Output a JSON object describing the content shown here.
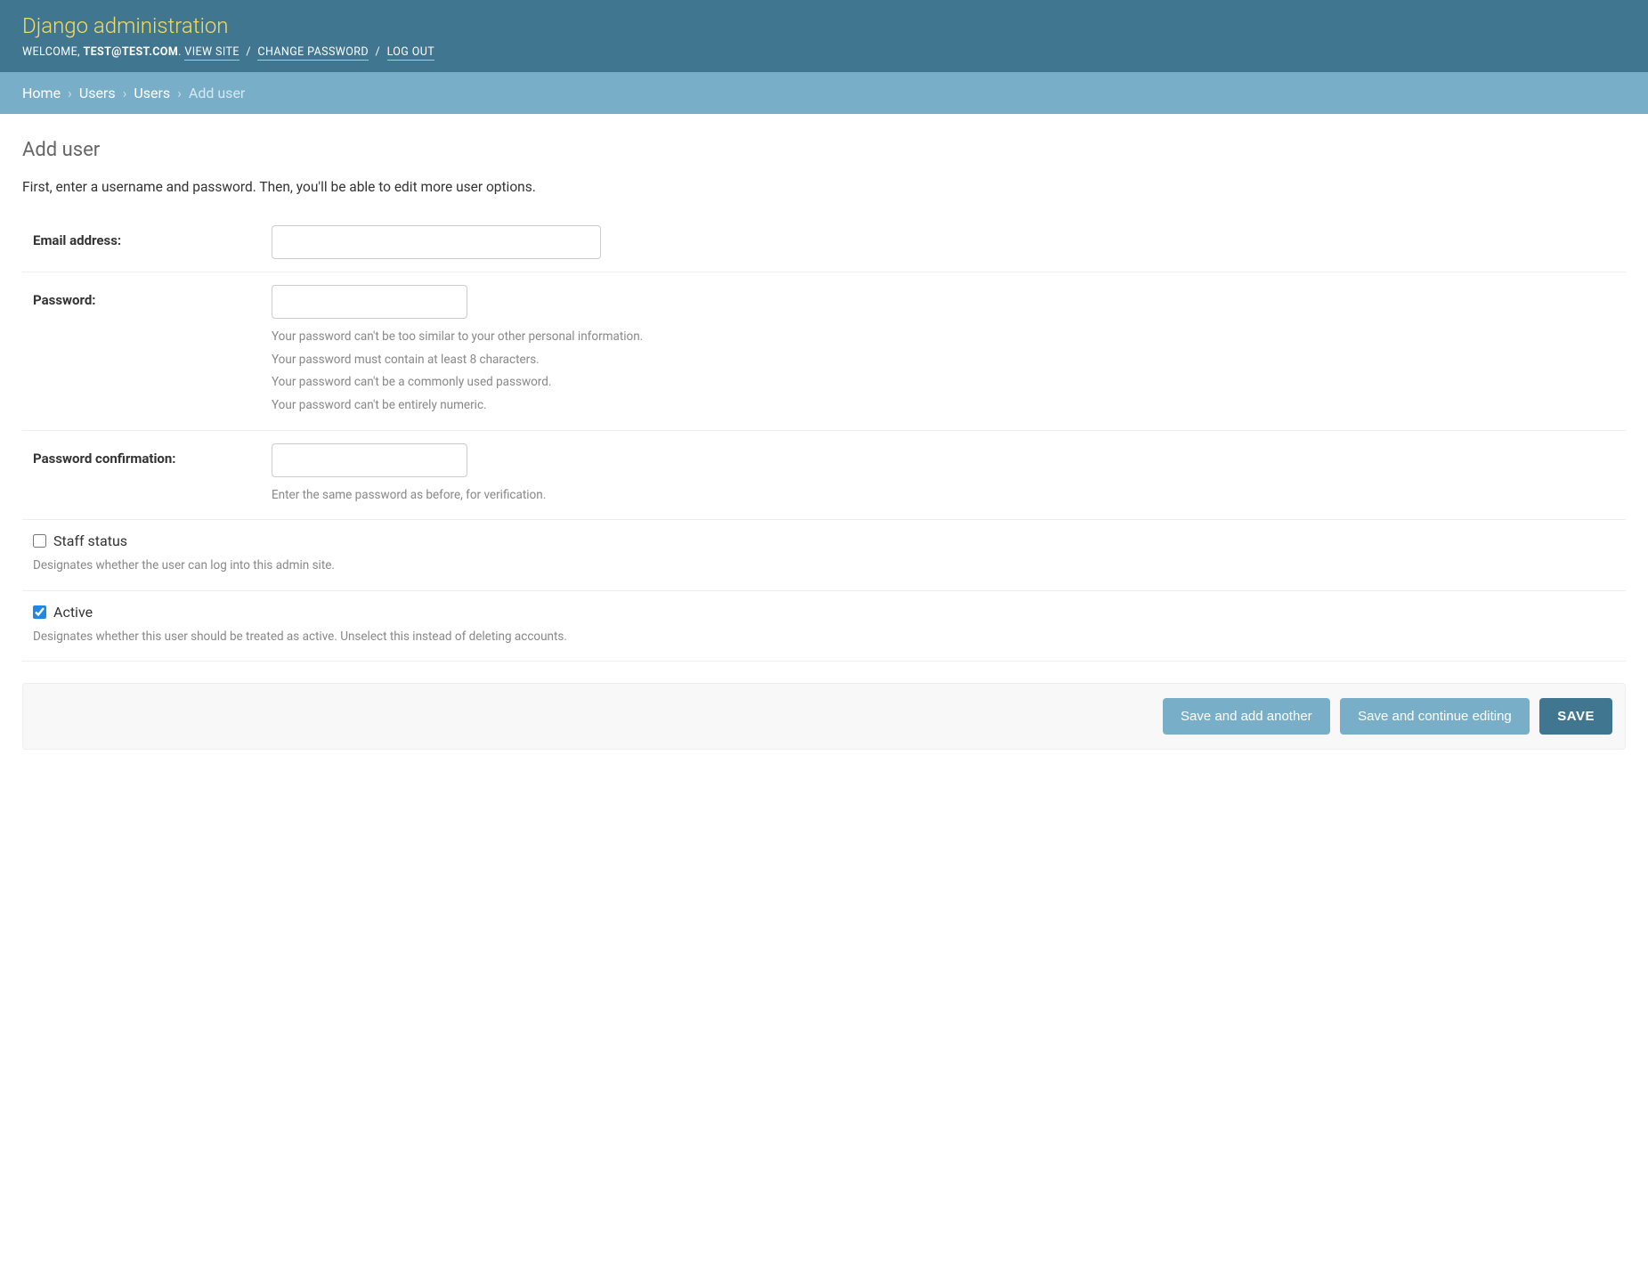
{
  "header": {
    "site_title": "Django administration",
    "welcome": "WELCOME, ",
    "user": "TEST@TEST.COM",
    "view_site": "VIEW SITE",
    "change_password": "CHANGE PASSWORD",
    "logout": "LOG OUT",
    "period": ". ",
    "slash": " / "
  },
  "breadcrumbs": {
    "items": [
      "Home",
      "Users",
      "Users"
    ],
    "current": "Add user",
    "sep": "›"
  },
  "page": {
    "title": "Add user",
    "intro": "First, enter a username and password. Then, you'll be able to edit more user options."
  },
  "fields": {
    "email": {
      "label": "Email address:",
      "value": ""
    },
    "password": {
      "label": "Password:",
      "value": "",
      "help": [
        "Your password can't be too similar to your other personal information.",
        "Your password must contain at least 8 characters.",
        "Your password can't be a commonly used password.",
        "Your password can't be entirely numeric."
      ]
    },
    "password_confirm": {
      "label": "Password confirmation:",
      "value": "",
      "help": "Enter the same password as before, for verification."
    },
    "staff_status": {
      "label": "Staff status",
      "checked": false,
      "help": "Designates whether the user can log into this admin site."
    },
    "active": {
      "label": "Active",
      "checked": true,
      "help": "Designates whether this user should be treated as active. Unselect this instead of deleting accounts."
    }
  },
  "buttons": {
    "save_add_another": "Save and add another",
    "save_continue": "Save and continue editing",
    "save": "SAVE"
  }
}
